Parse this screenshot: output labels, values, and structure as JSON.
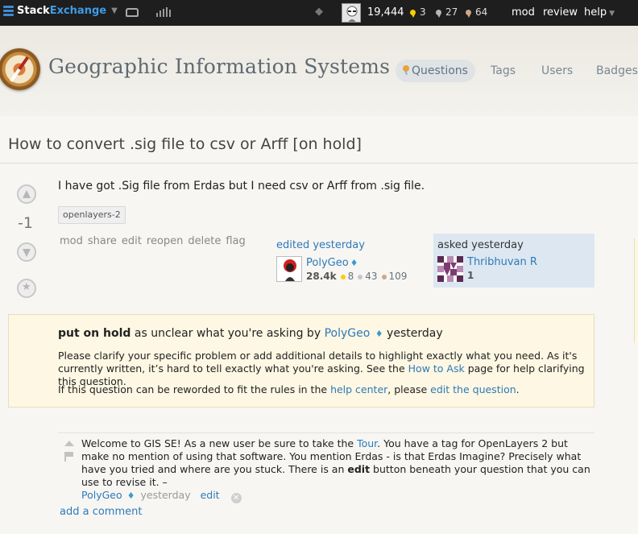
{
  "topbar": {
    "brand_part1": "Stack",
    "brand_part2": "Exchange",
    "reputation": "19,444",
    "gold_count": "3",
    "silver_count": "27",
    "bronze_count": "64",
    "mod_label": "mod",
    "review_label": "review",
    "help_label": "help"
  },
  "site": {
    "title": "Geographic Information Systems",
    "nav": {
      "questions": "Questions",
      "tags": "Tags",
      "users": "Users",
      "badges": "Badges"
    }
  },
  "question": {
    "title": "How to convert .sig file to csv or Arff [on hold]",
    "vote_count": "-1",
    "body": "I have got .Sig file from Erdas but I need csv or Arff from .sig file.",
    "tags": [
      "openlayers-2"
    ],
    "menu": [
      "mod",
      "share",
      "edit",
      "reopen",
      "delete",
      "flag"
    ],
    "edited": {
      "label": "edited yesterday",
      "user": "PolyGeo",
      "diamond": "♦",
      "rep": "28.4k",
      "gold": "8",
      "silver": "43",
      "bronze": "109"
    },
    "asked": {
      "label": "asked yesterday",
      "user": "Thribhuvan R",
      "rep": "1"
    }
  },
  "hold": {
    "status": "put on hold",
    "reason": " as unclear what you're asking by ",
    "by_user": "PolyGeo",
    "diamond": "♦",
    "when": " yesterday",
    "p1_text": "Please clarify your specific problem or add additional details to highlight exactly what you need. As it's currently written, it’s hard to tell exactly what you're asking. See the ",
    "p1_link": "How to Ask",
    "p1_tail": " page for help clarifying this question.",
    "p2_text": "If this question can be reworded to fit the rules in the ",
    "p2_link1": "help center",
    "p2_mid": ", please ",
    "p2_link2": "edit the question",
    "p2_tail": "."
  },
  "comment": {
    "text_a": "Welcome to GIS SE! As a new user be sure to take the ",
    "tour_link": "Tour",
    "text_b": ". You have a tag for OpenLayers 2 but make no mention of using that software. You mention Erdas - is that Erdas Imagine? Precisely what have you tried and where are you stuck. There is an ",
    "bold_word": "edit",
    "text_c": " button beneath your question that you can use to revise it. –",
    "user": "PolyGeo",
    "diamond": "♦",
    "date": "yesterday",
    "edit_label": "edit",
    "delete_glyph": "✕"
  },
  "add_comment": "add a comment",
  "icons": {
    "stack-icon": "stack-exchange-logo",
    "inbox-icon": "inbox",
    "achievements-icon": "achievements",
    "diamond-icon": "moderator-diamond",
    "compass-icon": "gis-compass-logo"
  },
  "colors": {
    "topbar_bg": "#1e1e1e",
    "link": "#2e7ab8",
    "hold_bg": "#fdf7e3",
    "asked_bg": "#dce7f1",
    "gold": "#ffcc01",
    "silver": "#b4b8bc",
    "bronze": "#d1a684"
  }
}
